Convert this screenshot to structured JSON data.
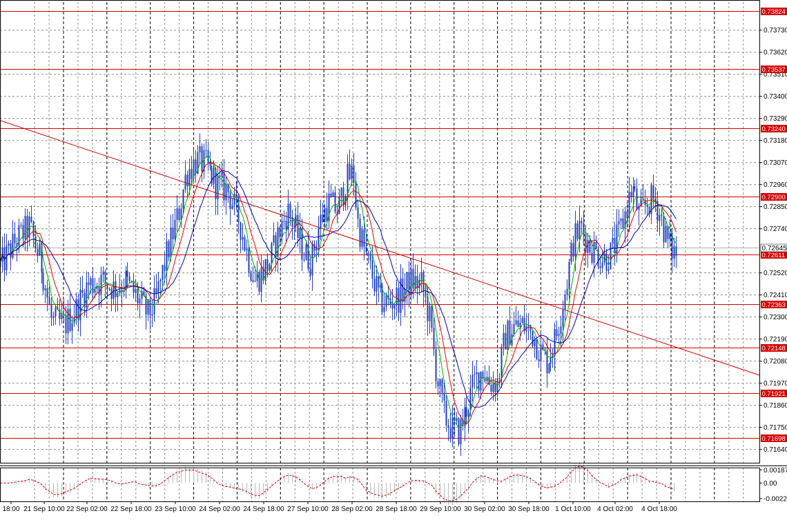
{
  "chart_data": {
    "type": "candlestick",
    "title": "",
    "ylim": [
      0.7157,
      0.7387
    ],
    "y_ticks": [
      "0.73730",
      "0.73620",
      "0.73510",
      "0.73400",
      "0.73290",
      "0.73180",
      "0.73070",
      "0.72960",
      "0.72850",
      "0.72740",
      "0.72520",
      "0.72410",
      "0.72300",
      "0.72190",
      "0.72080",
      "0.71970",
      "0.71860",
      "0.71750",
      "0.71640"
    ],
    "x_ticks": [
      "18:00",
      "21 Sep 10:00",
      "22 Sep 02:00",
      "22 Sep 18:00",
      "23 Sep 10:00",
      "24 Sep 02:00",
      "24 Sep 18:00",
      "27 Sep 10:00",
      "28 Sep 02:00",
      "28 Sep 18:00",
      "29 Sep 10:00",
      "30 Sep 02:00",
      "30 Sep 18:00",
      "1 Oct 10:00",
      "4 Oct 02:00",
      "4 Oct 18:00"
    ],
    "session_separators": 16,
    "support_resistance_levels": [
      {
        "label": "0.73824",
        "value": 0.73824
      },
      {
        "label": "0.73537",
        "value": 0.73537
      },
      {
        "label": "0.73240",
        "value": 0.7324
      },
      {
        "label": "0.72900",
        "value": 0.729
      },
      {
        "label": "0.72611",
        "value": 0.72611
      },
      {
        "label": "0.72363",
        "value": 0.72363
      },
      {
        "label": "0.72148",
        "value": 0.72148
      },
      {
        "label": "0.71921",
        "value": 0.71921
      },
      {
        "label": "0.71698",
        "value": 0.71698
      }
    ],
    "current_price": {
      "label": "0.72645",
      "value": 0.72645
    },
    "trendline": {
      "from": [
        0,
        0.7328
      ],
      "to": [
        1.0,
        0.7201
      ]
    },
    "price_path": [
      [
        0.0,
        0.7255
      ],
      [
        0.02,
        0.7268
      ],
      [
        0.038,
        0.7275
      ],
      [
        0.055,
        0.7255
      ],
      [
        0.068,
        0.7228
      ],
      [
        0.085,
        0.7226
      ],
      [
        0.1,
        0.7234
      ],
      [
        0.115,
        0.7246
      ],
      [
        0.135,
        0.7248
      ],
      [
        0.15,
        0.7244
      ],
      [
        0.165,
        0.7248
      ],
      [
        0.18,
        0.724
      ],
      [
        0.195,
        0.7231
      ],
      [
        0.205,
        0.7238
      ],
      [
        0.22,
        0.7262
      ],
      [
        0.235,
        0.7282
      ],
      [
        0.245,
        0.7302
      ],
      [
        0.258,
        0.7308
      ],
      [
        0.27,
        0.7306
      ],
      [
        0.285,
        0.7296
      ],
      [
        0.3,
        0.7293
      ],
      [
        0.315,
        0.7278
      ],
      [
        0.325,
        0.7262
      ],
      [
        0.335,
        0.7248
      ],
      [
        0.345,
        0.7252
      ],
      [
        0.355,
        0.7258
      ],
      [
        0.365,
        0.727
      ],
      [
        0.378,
        0.7283
      ],
      [
        0.39,
        0.7273
      ],
      [
        0.4,
        0.7262
      ],
      [
        0.41,
        0.7258
      ],
      [
        0.42,
        0.7276
      ],
      [
        0.432,
        0.7287
      ],
      [
        0.445,
        0.7283
      ],
      [
        0.455,
        0.7298
      ],
      [
        0.465,
        0.7302
      ],
      [
        0.47,
        0.7278
      ],
      [
        0.48,
        0.7262
      ],
      [
        0.49,
        0.725
      ],
      [
        0.5,
        0.7238
      ],
      [
        0.512,
        0.7237
      ],
      [
        0.525,
        0.724
      ],
      [
        0.54,
        0.7248
      ],
      [
        0.555,
        0.7246
      ],
      [
        0.565,
        0.723
      ],
      [
        0.575,
        0.72
      ],
      [
        0.585,
        0.718
      ],
      [
        0.595,
        0.7174
      ],
      [
        0.605,
        0.7173
      ],
      [
        0.615,
        0.7186
      ],
      [
        0.625,
        0.7198
      ],
      [
        0.635,
        0.7204
      ],
      [
        0.645,
        0.7197
      ],
      [
        0.655,
        0.7198
      ],
      [
        0.665,
        0.722
      ],
      [
        0.675,
        0.7225
      ],
      [
        0.688,
        0.7226
      ],
      [
        0.7,
        0.7222
      ],
      [
        0.712,
        0.7212
      ],
      [
        0.72,
        0.7208
      ],
      [
        0.732,
        0.722
      ],
      [
        0.745,
        0.7245
      ],
      [
        0.755,
        0.7268
      ],
      [
        0.765,
        0.7275
      ],
      [
        0.775,
        0.7266
      ],
      [
        0.785,
        0.7262
      ],
      [
        0.795,
        0.7259
      ],
      [
        0.805,
        0.7262
      ],
      [
        0.815,
        0.7272
      ],
      [
        0.825,
        0.7285
      ],
      [
        0.832,
        0.7295
      ],
      [
        0.842,
        0.728
      ],
      [
        0.852,
        0.7287
      ],
      [
        0.862,
        0.7289
      ],
      [
        0.87,
        0.728
      ],
      [
        0.878,
        0.7268
      ],
      [
        0.885,
        0.7263
      ],
      [
        0.89,
        0.7262
      ]
    ],
    "series": [
      {
        "name": "",
        "color": "#00b000",
        "values": []
      },
      {
        "name": "",
        "color": "#e00000",
        "values": []
      },
      {
        "name": "",
        "color": "#0000aa",
        "values": []
      }
    ],
    "oscillator": {
      "y_ticks": [
        "0.001873",
        "0.00",
        "-0.00220"
      ],
      "ylim": [
        -0.0026,
        0.0022
      ]
    },
    "colors": {
      "candle": "#1f3fbf",
      "level": "#d40000",
      "trend": "#cc0000",
      "grid": "#8c8c8c",
      "separator": "#000000"
    }
  }
}
